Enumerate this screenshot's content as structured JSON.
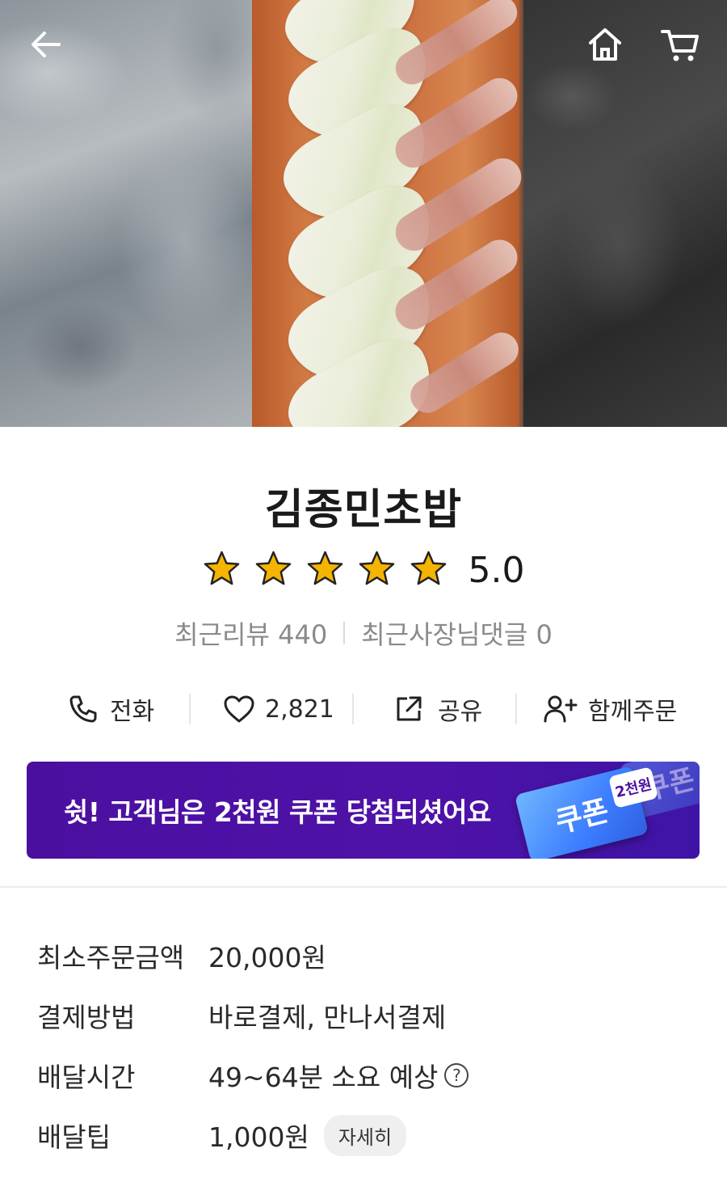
{
  "store": {
    "name": "김종민초밥",
    "rating": "5.0",
    "stars_filled": 5,
    "stars_total": 5,
    "recent_reviews": "최근리뷰 440",
    "owner_replies": "최근사장님댓글 0"
  },
  "actions": {
    "call_label": "전화",
    "like_count": "2,821",
    "share_label": "공유",
    "group_order_label": "함께주문"
  },
  "banner": {
    "text": "쉿! 고객님은 2천원 쿠폰 당첨되셨어요",
    "coupon_label": "쿠폰",
    "coupon_back_label": "쿠폰",
    "badge_label": "2천원"
  },
  "info": {
    "min_order_label": "최소주문금액",
    "min_order_value": "20,000원",
    "payment_label": "결제방법",
    "payment_value": "바로결제, 만나서결제",
    "delivery_time_label": "배달시간",
    "delivery_time_value": "49~64분 소요 예상",
    "delivery_tip_label": "배달팁",
    "delivery_tip_value": "1,000원",
    "detail_button": "자세히"
  },
  "colors": {
    "banner_bg": "#4b0fa0",
    "star": "#f5b400"
  },
  "icons": [
    "back-arrow-icon",
    "home-icon",
    "cart-icon",
    "phone-icon",
    "heart-icon",
    "share-icon",
    "add-user-icon",
    "help-icon",
    "star-icon"
  ]
}
